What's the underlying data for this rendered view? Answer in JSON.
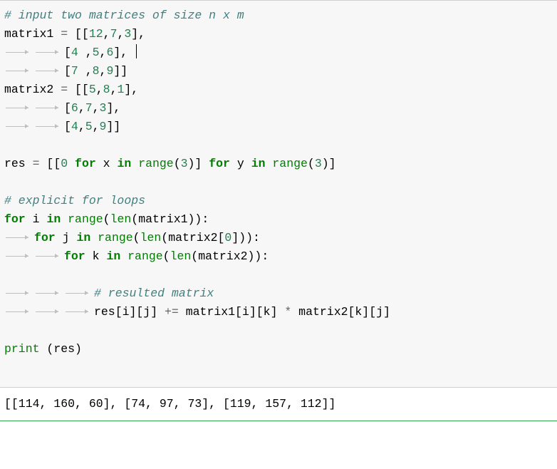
{
  "code": {
    "l1_comment": "# input two matrices of size n x m",
    "l2": {
      "a": "matrix1 ",
      "op": "=",
      "b": " [[",
      "n1": "12",
      "c": ",",
      "n2": "7",
      "c2": ",",
      "n3": "3",
      "d": "],"
    },
    "l3": {
      "a": "[",
      "n1": "4",
      "b": " ,",
      "n2": "5",
      "c": ",",
      "n3": "6",
      "d": "], "
    },
    "l4": {
      "a": "[",
      "n1": "7",
      "b": " ,",
      "n2": "8",
      "c": ",",
      "n3": "9",
      "d": "]]"
    },
    "l5": {
      "a": "matrix2 ",
      "op": "=",
      "b": " [[",
      "n1": "5",
      "c": ",",
      "n2": "8",
      "c2": ",",
      "n3": "1",
      "d": "],"
    },
    "l6": {
      "a": "[",
      "n1": "6",
      "b": ",",
      "n2": "7",
      "c": ",",
      "n3": "3",
      "d": "],"
    },
    "l7": {
      "a": "[",
      "n1": "4",
      "b": ",",
      "n2": "5",
      "c": ",",
      "n3": "9",
      "d": "]]"
    },
    "l9": {
      "a": "res ",
      "op1": "=",
      "b": " [[",
      "n1": "0",
      "sp": " ",
      "kw1": "for",
      "c": " x ",
      "kw2": "in",
      "d": " ",
      "bi": "range",
      "e": "(",
      "n2": "3",
      "f": ")] ",
      "kw3": "for",
      "g": " y ",
      "kw4": "in",
      "h": " ",
      "bi2": "range",
      "i": "(",
      "n3": "3",
      "j": ")]"
    },
    "l11_comment": "# explicit for loops",
    "l12": {
      "kw1": "for",
      "a": " i ",
      "kw2": "in",
      "b": " ",
      "bi": "range",
      "c": "(",
      "bi2": "len",
      "d": "(matrix1)):"
    },
    "l13": {
      "kw1": "for",
      "a": " j ",
      "kw2": "in",
      "b": " ",
      "bi": "range",
      "c": "(",
      "bi2": "len",
      "d": "(matrix2[",
      "n": "0",
      "e": "])):"
    },
    "l14": {
      "kw1": "for",
      "a": " k ",
      "kw2": "in",
      "b": " ",
      "bi": "range",
      "c": "(",
      "bi2": "len",
      "d": "(matrix2)):"
    },
    "l16_comment": "# resulted matrix",
    "l17": {
      "a": "res[i][j] ",
      "op1": "+=",
      "b": " matrix1[i][k] ",
      "op2": "*",
      "c": " matrix2[k][j]"
    },
    "l19": {
      "bi": "print",
      "a": " (res)"
    }
  },
  "output": "[[114, 160, 60], [74, 97, 73], [119, 157, 112]]"
}
